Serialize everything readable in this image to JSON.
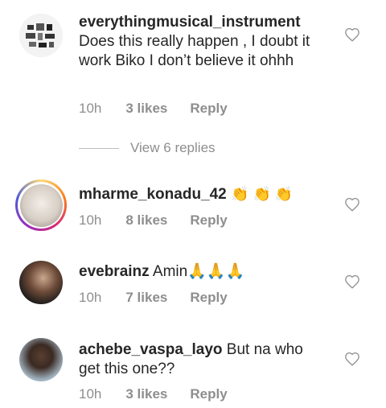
{
  "comments": [
    {
      "username": "everythingmusical_instrument",
      "text": "Does this really happen , I doubt it work Biko I don’t believe it ohhh",
      "time": "10h",
      "likes": "3 likes",
      "reply": "Reply"
    },
    {
      "username": "mharme_konadu_42",
      "text": "👏 👏 👏",
      "time": "10h",
      "likes": "8 likes",
      "reply": "Reply"
    },
    {
      "username": "evebrainz",
      "text": "Amin🙏🙏🙏",
      "time": "10h",
      "likes": "7 likes",
      "reply": "Reply"
    },
    {
      "username": "achebe_vaspa_layo",
      "text": "But na who get this one??",
      "time": "10h",
      "likes": "3 likes",
      "reply": "Reply"
    }
  ],
  "view_replies": "View 6 replies",
  "icons": {
    "like": "heart-outline-icon"
  },
  "colors": {
    "meta": "#8e8e8e",
    "text": "#262626"
  }
}
